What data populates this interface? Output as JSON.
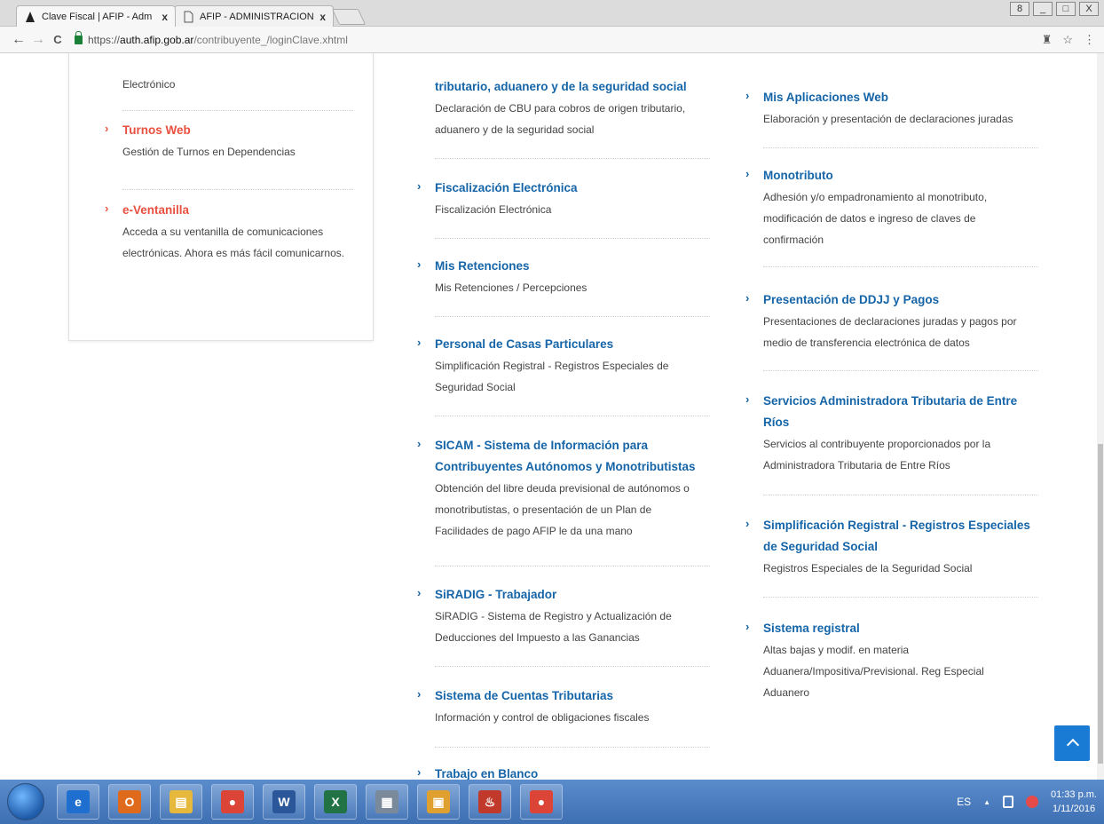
{
  "browser": {
    "tabs": [
      {
        "title": "Clave Fiscal | AFIP - Adm",
        "close": "x"
      },
      {
        "title": "AFIP - ADMINISTRACION",
        "close": "x"
      }
    ],
    "window_buttons": [
      "8",
      "_",
      "□",
      "X"
    ],
    "url_scheme": "https://",
    "url_host": "auth.afip.gob.ar",
    "url_path": "/contribuyente_/loginClave.xhtml",
    "back_icon": "←",
    "forward_icon": "→",
    "reload_icon": "C",
    "extension_icon": "♜",
    "star_icon": "☆",
    "menu_icon": "⋮"
  },
  "left_column": {
    "items": [
      {
        "title": "",
        "description": "Electrónico"
      },
      {
        "chevron": "›",
        "title": "Turnos Web",
        "description": "Gestión de Turnos en Dependencias"
      },
      {
        "chevron": "›",
        "title": "e-Ventanilla",
        "description": "Acceda a su ventanilla de comunicaciones electrónicas. Ahora es más fácil comunicarnos."
      }
    ]
  },
  "middle_column": {
    "items": [
      {
        "title": "tributario, aduanero y de la seguridad social",
        "description": "Declaración de CBU para cobros de origen tributario, aduanero y de la seguridad social"
      },
      {
        "chevron": "›",
        "title": "Fiscalización Electrónica",
        "description": "Fiscalización Electrónica"
      },
      {
        "chevron": "›",
        "title": "Mis Retenciones",
        "description": "Mis Retenciones / Percepciones"
      },
      {
        "chevron": "›",
        "title": "Personal de Casas Particulares",
        "description": "Simplificación Registral - Registros Especiales de Seguridad Social"
      },
      {
        "chevron": "›",
        "title": "SICAM - Sistema de Información para Contribuyentes Autónomos y Monotributistas",
        "description": "Obtención del libre deuda previsional de autónomos o monotributistas, o presentación de un Plan de Facilidades de pago AFIP le da una mano"
      },
      {
        "chevron": "›",
        "title": "SiRADIG - Trabajador",
        "description": "SiRADIG - Sistema de Registro y Actualización de Deducciones del Impuesto a las Ganancias"
      },
      {
        "chevron": "›",
        "title": "Sistema de Cuentas Tributarias",
        "description": "Información y control de obligaciones fiscales"
      },
      {
        "chevron": "›",
        "title": "Trabajo en Blanco",
        "description": ""
      }
    ]
  },
  "right_column": {
    "items": [
      {
        "chevron": "›",
        "title": "Mis Aplicaciones Web",
        "description": "Elaboración y presentación de declaraciones juradas"
      },
      {
        "chevron": "›",
        "title": "Monotributo",
        "description": "Adhesión y/o empadronamiento al monotributo, modificación de datos e ingreso de claves de confirmación"
      },
      {
        "chevron": "›",
        "title": "Presentación de DDJJ y Pagos",
        "description": "Presentaciones de declaraciones juradas y pagos por medio de transferencia electrónica de datos"
      },
      {
        "chevron": "›",
        "title": "Servicios Administradora Tributaria de Entre Ríos",
        "description": "Servicios al contribuyente proporcionados por la Administradora Tributaria de Entre Ríos"
      },
      {
        "chevron": "›",
        "title": "Simplificación Registral - Registros Especiales de Seguridad Social",
        "description": "Registros Especiales de la Seguridad Social"
      },
      {
        "chevron": "›",
        "title": "Sistema registral",
        "description": "Altas bajas y modif. en materia Aduanera/Impositiva/Previsional. Reg Especial Aduanero"
      }
    ]
  },
  "taskbar": {
    "language": "ES",
    "tray_arrow": "▲",
    "time": "01:33 p.m.",
    "date": "1/11/2016",
    "apps": [
      {
        "name": "ie",
        "glyph": "e",
        "color": "#1f6fd0"
      },
      {
        "name": "office",
        "glyph": "O",
        "color": "#e06a1b"
      },
      {
        "name": "explorer",
        "glyph": "▤",
        "color": "#e6b93d"
      },
      {
        "name": "chrome",
        "glyph": "●",
        "color": "#db4437"
      },
      {
        "name": "word",
        "glyph": "W",
        "color": "#2b579a"
      },
      {
        "name": "excel",
        "glyph": "X",
        "color": "#217346"
      },
      {
        "name": "calculator",
        "glyph": "▦",
        "color": "#7a8a9a"
      },
      {
        "name": "calendar",
        "glyph": "▣",
        "color": "#e0a030"
      },
      {
        "name": "java",
        "glyph": "♨",
        "color": "#c0392b"
      },
      {
        "name": "chrome2",
        "glyph": "●",
        "color": "#db4437"
      }
    ]
  },
  "colors": {
    "accent_orange": "#e8503f",
    "link_blue": "#1565a8",
    "top_button": "#1a7bd4"
  }
}
